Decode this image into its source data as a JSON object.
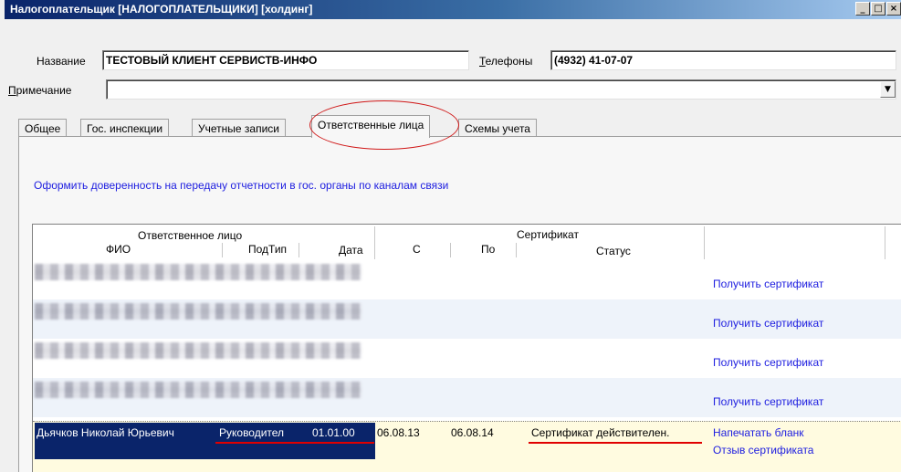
{
  "window": {
    "title": "Налогоплательщик [НАЛОГОПЛАТЕЛЬЩИКИ] [холдинг]",
    "buttons": {
      "minimize": "_",
      "maximize": "□",
      "close": "×"
    }
  },
  "form": {
    "name_label": "Название",
    "name_value": "ТЕСТОВЫЙ КЛИЕНТ СЕРВИСТВ-ИНФО",
    "phones_label_accel": "Т",
    "phones_label_rest": "елефоны",
    "phones_value": "(4932) 41-07-07",
    "note_label_accel": "П",
    "note_label_rest": "римечание",
    "note_value": ""
  },
  "tabs": [
    {
      "label": "Общее"
    },
    {
      "label": "Гос. инспекции"
    },
    {
      "label": "Учетные записи"
    },
    {
      "label": "Ответственные лица"
    },
    {
      "label": "Схемы учета"
    }
  ],
  "panel": {
    "proxy_link": "Оформить доверенность на передачу отчетности в гос. органы по каналам связи"
  },
  "grid": {
    "group_person": "Ответственное лицо",
    "group_certificate": "Сертификат",
    "col_fio": "ФИО",
    "col_subtype": "ПодТип",
    "col_date": "Дата",
    "col_from": "С",
    "col_to": "По",
    "col_status": "Статус",
    "rows": [
      {
        "action": "Получить сертификат"
      },
      {
        "action": "Получить сертификат"
      },
      {
        "action": "Получить сертификат"
      },
      {
        "action": "Получить сертификат"
      }
    ],
    "selected_row": {
      "fio": "Дьячков Николай Юрьевич",
      "subtype": "Руководител",
      "date": "01.01.00",
      "from": "06.08.13",
      "to": "06.08.14",
      "status": "Сертификат действителен.",
      "action1": "Напечатать бланк",
      "action2": "Отзыв сертификата"
    }
  },
  "colors": {
    "title_bar": "#0a246a",
    "link": "#2020e0",
    "selection": "#0a246a",
    "annotation": "#e00000"
  }
}
